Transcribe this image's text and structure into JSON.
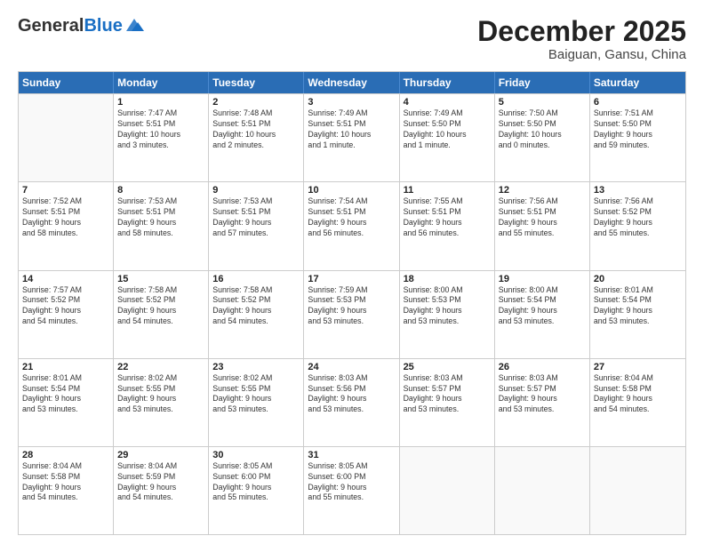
{
  "header": {
    "logo_general": "General",
    "logo_blue": "Blue",
    "month_title": "December 2025",
    "location": "Baiguan, Gansu, China"
  },
  "days_of_week": [
    "Sunday",
    "Monday",
    "Tuesday",
    "Wednesday",
    "Thursday",
    "Friday",
    "Saturday"
  ],
  "weeks": [
    [
      {
        "day": "",
        "info": ""
      },
      {
        "day": "1",
        "info": "Sunrise: 7:47 AM\nSunset: 5:51 PM\nDaylight: 10 hours\nand 3 minutes."
      },
      {
        "day": "2",
        "info": "Sunrise: 7:48 AM\nSunset: 5:51 PM\nDaylight: 10 hours\nand 2 minutes."
      },
      {
        "day": "3",
        "info": "Sunrise: 7:49 AM\nSunset: 5:51 PM\nDaylight: 10 hours\nand 1 minute."
      },
      {
        "day": "4",
        "info": "Sunrise: 7:49 AM\nSunset: 5:50 PM\nDaylight: 10 hours\nand 1 minute."
      },
      {
        "day": "5",
        "info": "Sunrise: 7:50 AM\nSunset: 5:50 PM\nDaylight: 10 hours\nand 0 minutes."
      },
      {
        "day": "6",
        "info": "Sunrise: 7:51 AM\nSunset: 5:50 PM\nDaylight: 9 hours\nand 59 minutes."
      }
    ],
    [
      {
        "day": "7",
        "info": "Sunrise: 7:52 AM\nSunset: 5:51 PM\nDaylight: 9 hours\nand 58 minutes."
      },
      {
        "day": "8",
        "info": "Sunrise: 7:53 AM\nSunset: 5:51 PM\nDaylight: 9 hours\nand 58 minutes."
      },
      {
        "day": "9",
        "info": "Sunrise: 7:53 AM\nSunset: 5:51 PM\nDaylight: 9 hours\nand 57 minutes."
      },
      {
        "day": "10",
        "info": "Sunrise: 7:54 AM\nSunset: 5:51 PM\nDaylight: 9 hours\nand 56 minutes."
      },
      {
        "day": "11",
        "info": "Sunrise: 7:55 AM\nSunset: 5:51 PM\nDaylight: 9 hours\nand 56 minutes."
      },
      {
        "day": "12",
        "info": "Sunrise: 7:56 AM\nSunset: 5:51 PM\nDaylight: 9 hours\nand 55 minutes."
      },
      {
        "day": "13",
        "info": "Sunrise: 7:56 AM\nSunset: 5:52 PM\nDaylight: 9 hours\nand 55 minutes."
      }
    ],
    [
      {
        "day": "14",
        "info": "Sunrise: 7:57 AM\nSunset: 5:52 PM\nDaylight: 9 hours\nand 54 minutes."
      },
      {
        "day": "15",
        "info": "Sunrise: 7:58 AM\nSunset: 5:52 PM\nDaylight: 9 hours\nand 54 minutes."
      },
      {
        "day": "16",
        "info": "Sunrise: 7:58 AM\nSunset: 5:52 PM\nDaylight: 9 hours\nand 54 minutes."
      },
      {
        "day": "17",
        "info": "Sunrise: 7:59 AM\nSunset: 5:53 PM\nDaylight: 9 hours\nand 53 minutes."
      },
      {
        "day": "18",
        "info": "Sunrise: 8:00 AM\nSunset: 5:53 PM\nDaylight: 9 hours\nand 53 minutes."
      },
      {
        "day": "19",
        "info": "Sunrise: 8:00 AM\nSunset: 5:54 PM\nDaylight: 9 hours\nand 53 minutes."
      },
      {
        "day": "20",
        "info": "Sunrise: 8:01 AM\nSunset: 5:54 PM\nDaylight: 9 hours\nand 53 minutes."
      }
    ],
    [
      {
        "day": "21",
        "info": "Sunrise: 8:01 AM\nSunset: 5:54 PM\nDaylight: 9 hours\nand 53 minutes."
      },
      {
        "day": "22",
        "info": "Sunrise: 8:02 AM\nSunset: 5:55 PM\nDaylight: 9 hours\nand 53 minutes."
      },
      {
        "day": "23",
        "info": "Sunrise: 8:02 AM\nSunset: 5:55 PM\nDaylight: 9 hours\nand 53 minutes."
      },
      {
        "day": "24",
        "info": "Sunrise: 8:03 AM\nSunset: 5:56 PM\nDaylight: 9 hours\nand 53 minutes."
      },
      {
        "day": "25",
        "info": "Sunrise: 8:03 AM\nSunset: 5:57 PM\nDaylight: 9 hours\nand 53 minutes."
      },
      {
        "day": "26",
        "info": "Sunrise: 8:03 AM\nSunset: 5:57 PM\nDaylight: 9 hours\nand 53 minutes."
      },
      {
        "day": "27",
        "info": "Sunrise: 8:04 AM\nSunset: 5:58 PM\nDaylight: 9 hours\nand 54 minutes."
      }
    ],
    [
      {
        "day": "28",
        "info": "Sunrise: 8:04 AM\nSunset: 5:58 PM\nDaylight: 9 hours\nand 54 minutes."
      },
      {
        "day": "29",
        "info": "Sunrise: 8:04 AM\nSunset: 5:59 PM\nDaylight: 9 hours\nand 54 minutes."
      },
      {
        "day": "30",
        "info": "Sunrise: 8:05 AM\nSunset: 6:00 PM\nDaylight: 9 hours\nand 55 minutes."
      },
      {
        "day": "31",
        "info": "Sunrise: 8:05 AM\nSunset: 6:00 PM\nDaylight: 9 hours\nand 55 minutes."
      },
      {
        "day": "",
        "info": ""
      },
      {
        "day": "",
        "info": ""
      },
      {
        "day": "",
        "info": ""
      }
    ]
  ]
}
